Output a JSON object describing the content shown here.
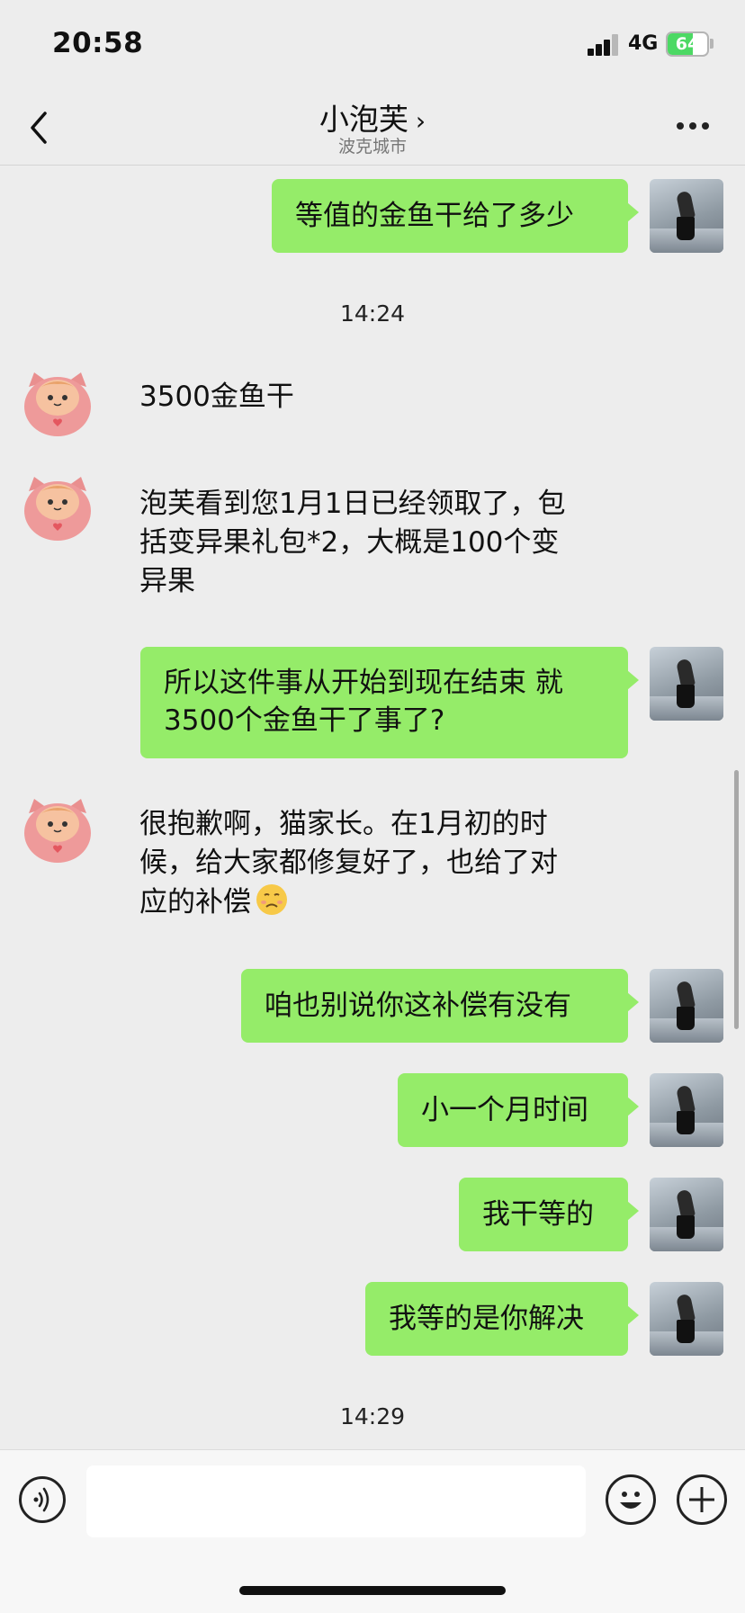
{
  "status": {
    "time": "20:58",
    "network": "4G",
    "battery": "64",
    "battery_level": 0.64
  },
  "nav": {
    "title": "小泡芙",
    "title_chevron": "›",
    "subtitle": "波克城市"
  },
  "messages": {
    "m1": "等值的金鱼干给了多少",
    "t1": "14:24",
    "m2": "3500金鱼干",
    "m3_l1": "泡芙看到您1月1日已经领取了，包",
    "m3_l2": "括变异果礼包*2，大概是100个变",
    "m3_l3": "异果",
    "m4_l1": "所以这件事从开始到现在结束 就",
    "m4_l2": "3500个金鱼干了事了?",
    "m5_l1": "很抱歉啊，猫家长。在1月初的时",
    "m5_l2": "候，给大家都修复好了，也给了对",
    "m5_l3": "应的补偿",
    "m6": "咱也别说你这补偿有没有",
    "m7": "小一个月时间",
    "m8": "我干等的",
    "m9": "我等的是你解决",
    "t2": "14:29"
  },
  "icons": {
    "back": "chevron-left-icon",
    "more": "more-dots-icon",
    "voice": "voice-icon",
    "emoji": "emoji-icon",
    "plus": "plus-icon"
  },
  "colors": {
    "bubble_out": "#95ec69",
    "background": "#ededed",
    "battery_fill": "#4cd964"
  }
}
